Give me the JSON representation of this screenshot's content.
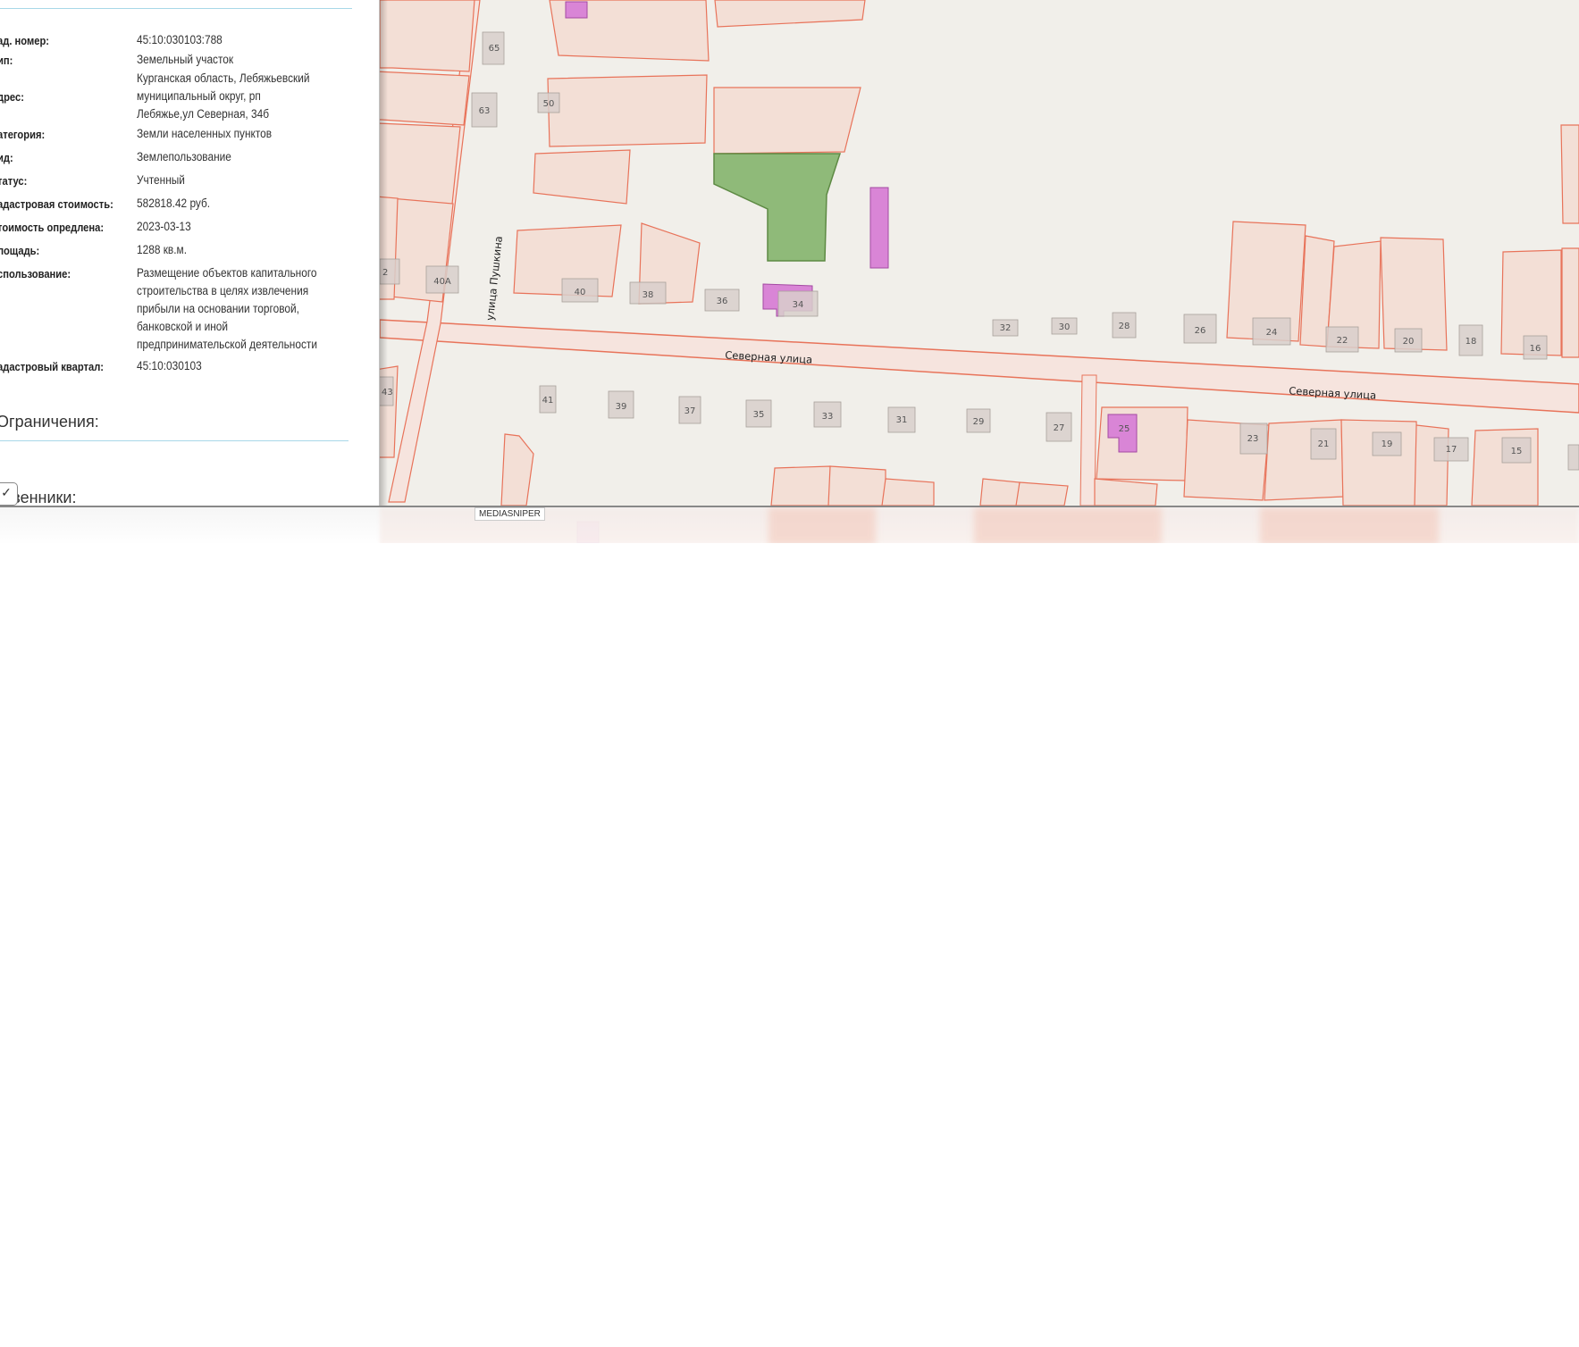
{
  "properties": [
    {
      "label": "ад. номер:",
      "value": "45:10:030103:788"
    },
    {
      "label": "ип:",
      "value": "Земельный участок"
    },
    {
      "label": "дрес:",
      "value": "Курганская область, Лебяжьевский муниципальный округ, рп Лебяжье,ул Северная, 34б"
    },
    {
      "label": "атегория:",
      "value": "Земли населенных пунктов"
    },
    {
      "label": "ид:",
      "value": "Землепользование"
    },
    {
      "label": "татус:",
      "value": "Учтенный"
    },
    {
      "label": "адастровая стоимость:",
      "value": "582818.42 руб."
    },
    {
      "label": "тоимость опредлена:",
      "value": "2023-03-13"
    },
    {
      "label": "лощадь:",
      "value": "1288 кв.м."
    },
    {
      "label": "спользование:",
      "value": "Размещение объектов капитального строительства в целях извлечения прибыли на основании торговой, банковской и иной предпринимательской деятельности"
    },
    {
      "label": "адастровый квартал:",
      "value": "45:10:030103"
    }
  ],
  "sections": {
    "restrictions": "Ограничения:",
    "owners": "ственники:"
  },
  "collapse_button": "✓",
  "map": {
    "streets": {
      "severnaya_1": "Северная улица",
      "severnaya_2": "Северная улица",
      "pushkina": "улица Пушкина"
    },
    "house_numbers": [
      "65",
      "63",
      "50",
      "2",
      "40А",
      "40",
      "38",
      "36",
      "34",
      "32",
      "30",
      "28",
      "26",
      "24",
      "22",
      "20",
      "18",
      "16",
      "43",
      "41",
      "39",
      "37",
      "35",
      "33",
      "31",
      "29",
      "27",
      "25",
      "23",
      "21",
      "19",
      "17",
      "15"
    ],
    "colors": {
      "background": "#f1efea",
      "parcel_fill": "#f3dfd6",
      "parcel_stroke": "#e8735a",
      "selected_parcel": "#8fba79",
      "building": "#d985d6",
      "street_fill": "#f6e4de"
    }
  },
  "watermark": "MEDIASNIPER"
}
